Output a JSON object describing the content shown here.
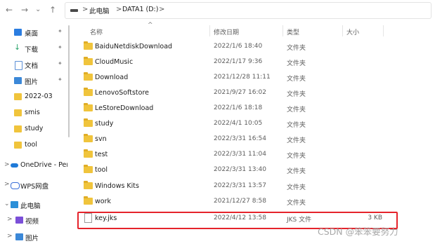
{
  "nav": {
    "back_icon": "←",
    "forward_icon": "→",
    "recent_icon": "⌄",
    "up_icon": "↑",
    "drive_icon": "drive-icon",
    "separator": ">",
    "crumbs": [
      "此电脑",
      "DATA1 (D:)"
    ]
  },
  "sidebar": {
    "items": [
      {
        "label": "桌面",
        "icon": "desktop-icon",
        "color": "#2b7de0",
        "pinned": true
      },
      {
        "label": "下载",
        "icon": "download-icon",
        "color": "#2aa36b",
        "pinned": true
      },
      {
        "label": "文档",
        "icon": "document-icon",
        "color": "#5b8fd6",
        "pinned": true
      },
      {
        "label": "图片",
        "icon": "pictures-icon",
        "color": "#3b88d8",
        "pinned": true
      },
      {
        "label": "2022-03",
        "icon": "folder-icon",
        "color": "#f0c43c",
        "pinned": false
      },
      {
        "label": "smis",
        "icon": "folder-icon",
        "color": "#f0c43c",
        "pinned": false
      },
      {
        "label": "study",
        "icon": "folder-icon",
        "color": "#f0c43c",
        "pinned": false
      },
      {
        "label": "tool",
        "icon": "folder-icon",
        "color": "#f0c43c",
        "pinned": false
      },
      {
        "label": "OneDrive - Per",
        "icon": "onedrive-icon",
        "color": "#1f7ad8",
        "pinned": false,
        "expander": ">"
      },
      {
        "label": "WPS网盘",
        "icon": "wps-cloud-icon",
        "color": "#3a6fd8",
        "pinned": false,
        "expander": ">"
      },
      {
        "label": "此电脑",
        "icon": "computer-icon",
        "color": "#2b8fd8",
        "pinned": false,
        "expander": "⌄"
      },
      {
        "label": "视频",
        "icon": "videos-icon",
        "color": "#7b4fd8",
        "pinned": false,
        "expander": ">"
      },
      {
        "label": "图片",
        "icon": "pictures-icon",
        "color": "#3b88d8",
        "pinned": false,
        "expander": ">"
      }
    ],
    "pin_icon": "📌"
  },
  "columns": {
    "name": "名称",
    "date": "修改日期",
    "type": "类型",
    "size": "大小",
    "sort_icon": "^"
  },
  "files": [
    {
      "name": "BaiduNetdiskDownload",
      "date": "2022/1/6 18:40",
      "type": "文件夹",
      "size": "",
      "kind": "folder"
    },
    {
      "name": "CloudMusic",
      "date": "2022/1/17 9:36",
      "type": "文件夹",
      "size": "",
      "kind": "folder"
    },
    {
      "name": "Download",
      "date": "2021/12/28 11:11",
      "type": "文件夹",
      "size": "",
      "kind": "folder"
    },
    {
      "name": "LenovoSoftstore",
      "date": "2021/9/27 16:02",
      "type": "文件夹",
      "size": "",
      "kind": "folder"
    },
    {
      "name": "LeStoreDownload",
      "date": "2022/1/6 18:18",
      "type": "文件夹",
      "size": "",
      "kind": "folder"
    },
    {
      "name": "study",
      "date": "2022/4/1 10:05",
      "type": "文件夹",
      "size": "",
      "kind": "folder"
    },
    {
      "name": "svn",
      "date": "2022/3/31 16:54",
      "type": "文件夹",
      "size": "",
      "kind": "folder"
    },
    {
      "name": "test",
      "date": "2022/3/31 11:04",
      "type": "文件夹",
      "size": "",
      "kind": "folder"
    },
    {
      "name": "tool",
      "date": "2022/3/31 13:40",
      "type": "文件夹",
      "size": "",
      "kind": "folder"
    },
    {
      "name": "Windows Kits",
      "date": "2022/3/31 13:57",
      "type": "文件夹",
      "size": "",
      "kind": "folder"
    },
    {
      "name": "work",
      "date": "2021/12/27 8:58",
      "type": "文件夹",
      "size": "",
      "kind": "folder"
    },
    {
      "name": "key.jks",
      "date": "2022/4/12 13:58",
      "type": "JKS 文件",
      "size": "3 KB",
      "kind": "file"
    }
  ],
  "highlight_color": "#e5232b",
  "watermark": "CSDN @笨笨要努力"
}
